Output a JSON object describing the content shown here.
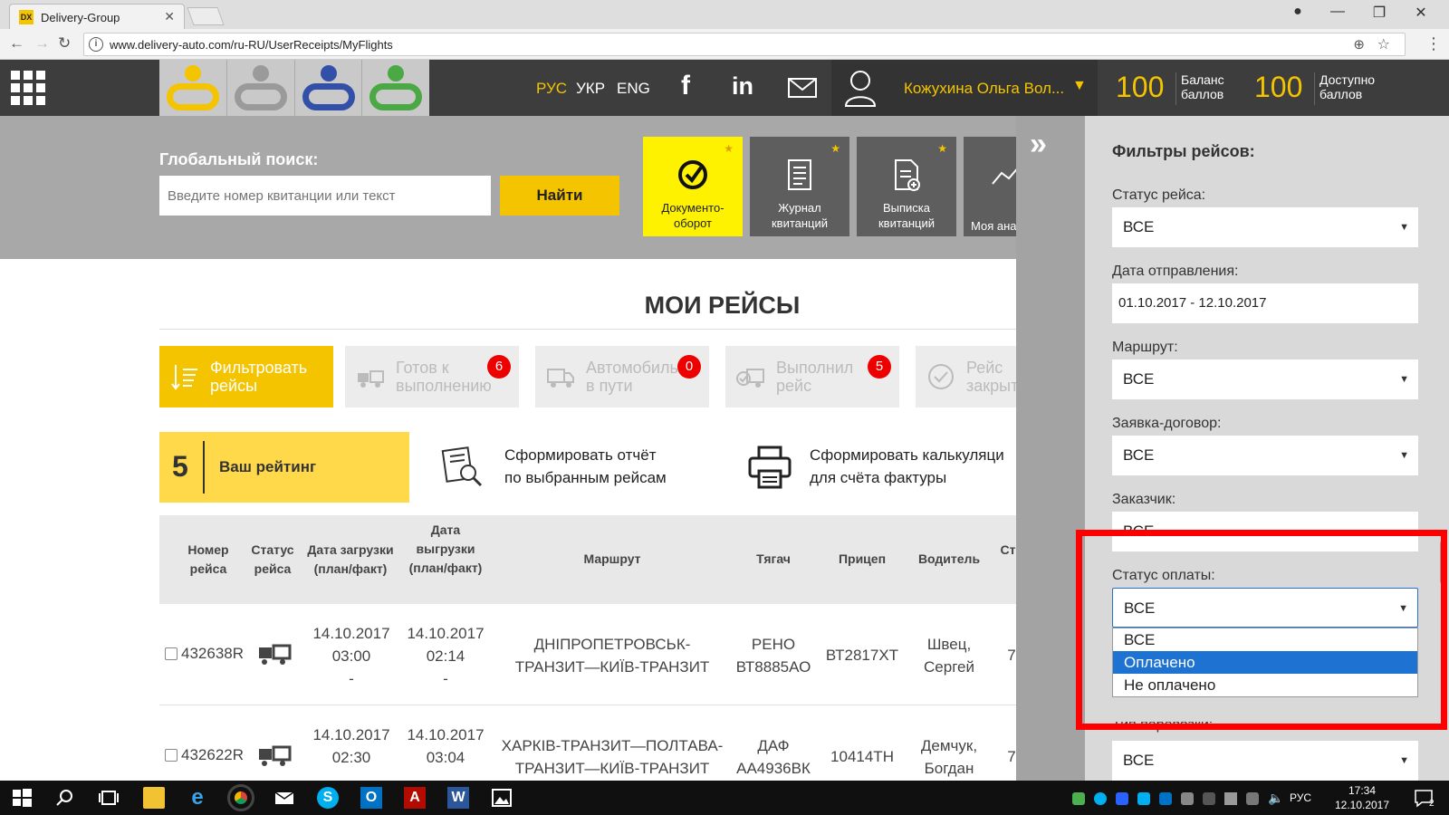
{
  "browser": {
    "tab_favicon_text": "DX",
    "tab_title": "Delivery-Group",
    "url": "www.delivery-auto.com/ru-RU/UserReceipts/MyFlights"
  },
  "header": {
    "languages": [
      "РУС",
      "УКР",
      "ENG"
    ],
    "active_language": "РУС",
    "user_name": "Кожухина Ольга Вол...",
    "balance_value": "100",
    "balance_label_1": "Баланс",
    "balance_label_2": "баллов",
    "available_value": "100",
    "available_label_1": "Доступно",
    "available_label_2": "баллов",
    "accent_color": "#f5c400"
  },
  "search": {
    "title": "Глобальный поиск:",
    "placeholder": "Введите номер квитанции или текст",
    "button": "Найти"
  },
  "quick_tiles": [
    {
      "label_1": "Документо-",
      "label_2": "оборот"
    },
    {
      "label_1": "Журнал",
      "label_2": "квитанций"
    },
    {
      "label_1": "Выписка",
      "label_2": "квитанций"
    },
    {
      "label_1": "Моя ана",
      "label_2": ""
    }
  ],
  "main": {
    "title": "МОИ РЕЙСЫ",
    "filters": [
      {
        "label_1": "Фильтровать",
        "label_2": "рейсы",
        "badge": ""
      },
      {
        "label_1": "Готов к",
        "label_2": "выполнению",
        "badge": "6"
      },
      {
        "label_1": "Автомобиль",
        "label_2": "в пути",
        "badge": "0"
      },
      {
        "label_1": "Выполнил",
        "label_2": "рейс",
        "badge": "5"
      },
      {
        "label_1": "Рейс",
        "label_2": "закрыт",
        "badge": ""
      }
    ],
    "rating_value": "5",
    "rating_label": "Ваш рейтинг",
    "report_1": "Сформировать отчёт",
    "report_2": "по выбранным рейсам",
    "calc_1": "Сформировать калькуляци",
    "calc_2": "для счёта фактуры"
  },
  "table": {
    "headers": [
      {
        "l1": "Номер",
        "l2": "рейса",
        "l3": ""
      },
      {
        "l1": "Статус",
        "l2": "рейса",
        "l3": ""
      },
      {
        "l1": "Дата загрузки",
        "l2": "(план/факт)",
        "l3": ""
      },
      {
        "l1": "Дата",
        "l2": "выгрузки",
        "l3": "(план/факт)"
      },
      {
        "l1": "Маршрут",
        "l2": "",
        "l3": ""
      },
      {
        "l1": "Тягач",
        "l2": "",
        "l3": ""
      },
      {
        "l1": "Прицеп",
        "l2": "",
        "l3": ""
      },
      {
        "l1": "Водитель",
        "l2": "",
        "l3": ""
      },
      {
        "l1": "Ст",
        "l2": "",
        "l3": ""
      }
    ],
    "rows": [
      {
        "number": "432638R",
        "load_date": "14.10.2017",
        "load_time": "03:00",
        "load_fact": "-",
        "unload_date": "14.10.2017",
        "unload_time": "02:14",
        "unload_fact": "-",
        "route_1": "ДНІПРОПЕТРОВСЬК-",
        "route_2": "ТРАНЗИТ—КИЇВ-ТРАНЗИТ",
        "tractor_1": "РЕНО",
        "tractor_2": "ВТ8885АО",
        "trailer": "ВТ2817ХТ",
        "driver_1": "Швец,",
        "driver_2": "Сергей",
        "extra": "7"
      },
      {
        "number": "432622R",
        "load_date": "14.10.2017",
        "load_time": "02:30",
        "load_fact": "",
        "unload_date": "14.10.2017",
        "unload_time": "03:04",
        "unload_fact": "",
        "route_1": "ХАРКІВ-ТРАНЗИТ—ПОЛТАВА-",
        "route_2": "ТРАНЗИТ—КИЇВ-ТРАНЗИТ",
        "tractor_1": "ДАФ",
        "tractor_2": "АА4936ВК",
        "trailer": "10414ТН",
        "driver_1": "Демчук,",
        "driver_2": "Богдан",
        "extra": "7"
      }
    ]
  },
  "filter_panel": {
    "title": "Фильтры рейсов:",
    "status_label": "Статус рейса:",
    "status_value": "ВСЕ",
    "date_label": "Дата отправления:",
    "date_value": "01.10.2017 - 12.10.2017",
    "route_label": "Маршрут:",
    "route_value": "ВСЕ",
    "contract_label": "Заявка-договор:",
    "contract_value": "ВСЕ",
    "customer_label": "Заказчик:",
    "customer_value": "ВСЕ",
    "payment_label": "Статус оплаты:",
    "payment_value": "ВСЕ",
    "payment_options": [
      "ВСЕ",
      "Оплачено",
      "Не оплачено"
    ],
    "payment_highlighted": "Оплачено",
    "transport_label": "Тип перевозки:",
    "transport_value": "ВСЕ"
  },
  "taskbar": {
    "language": "РУС",
    "time": "17:34",
    "date": "12.10.2017",
    "notifications": "2"
  }
}
